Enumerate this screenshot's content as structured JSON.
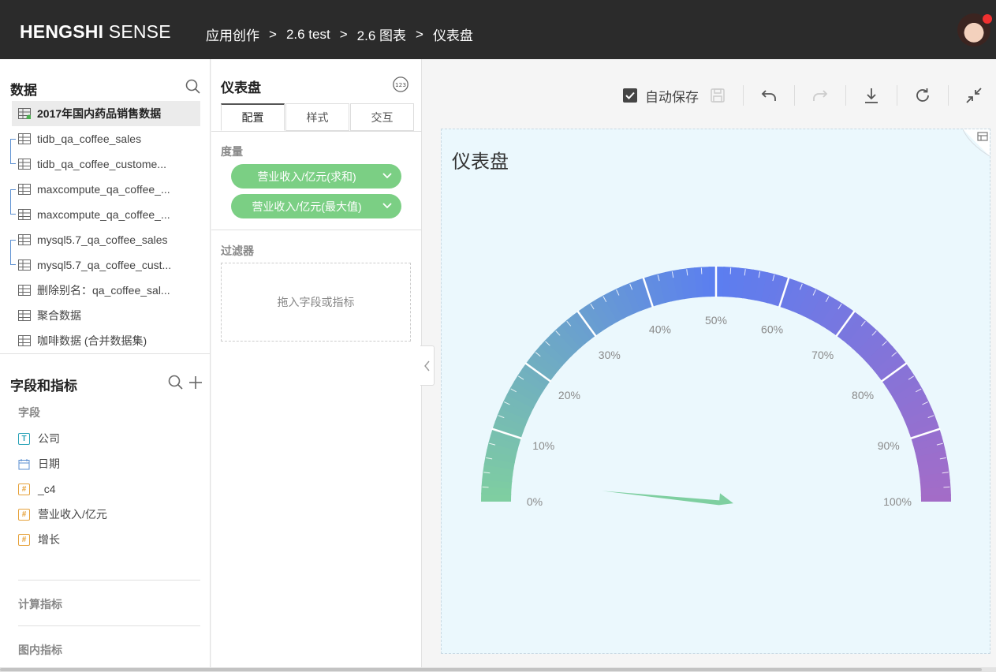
{
  "app": {
    "brand_bold": "HENGSHI",
    "brand_rest": " SENSE"
  },
  "breadcrumb": [
    "应用创作",
    "2.6 test",
    "2.6 图表",
    "仪表盘"
  ],
  "breadcrumb_sep": ">",
  "left": {
    "data_title": "数据",
    "datasets": [
      "2017年国内药品销售数据",
      "tidb_qa_coffee_sales",
      "tidb_qa_coffee_custome...",
      "maxcompute_qa_coffee_...",
      "maxcompute_qa_coffee_...",
      "mysql5.7_qa_coffee_sales",
      "mysql5.7_qa_coffee_cust...",
      "删除别名：qa_coffee_sal...",
      "聚合数据",
      "咖啡数据 (合并数据集)"
    ],
    "fields_title": "字段和指标",
    "fields_label": "字段",
    "fields": [
      {
        "name": "公司",
        "type": "T"
      },
      {
        "name": "日期",
        "type": "date"
      },
      {
        "name": "_c4",
        "type": "#"
      },
      {
        "name": "营业收入/亿元",
        "type": "#"
      },
      {
        "name": "增长",
        "type": "#"
      }
    ],
    "calc_label": "计算指标",
    "inchart_label": "图内指标"
  },
  "mid": {
    "title": "仪表盘",
    "tabs": [
      "配置",
      "样式",
      "交互"
    ],
    "measure_label": "度量",
    "measures": [
      "营业收入/亿元(求和)",
      "营业收入/亿元(最大值)"
    ],
    "filter_label": "过滤器",
    "filter_placeholder": "拖入字段或指标"
  },
  "toolbar": {
    "autosave_label": "自动保存",
    "autosave_checked": true
  },
  "canvas": {
    "title": "仪表盘"
  },
  "chart_data": {
    "type": "gauge",
    "title": "仪表盘",
    "min": 0,
    "max": 100,
    "tick_labels": [
      "0%",
      "10%",
      "20%",
      "30%",
      "40%",
      "50%",
      "60%",
      "70%",
      "80%",
      "90%",
      "100%"
    ],
    "value_percent": 3,
    "color_start": "#7fcfa0",
    "color_mid": "#5b7ef0",
    "color_end": "#a46cc7",
    "pointer_color": "#7ecfa0"
  }
}
